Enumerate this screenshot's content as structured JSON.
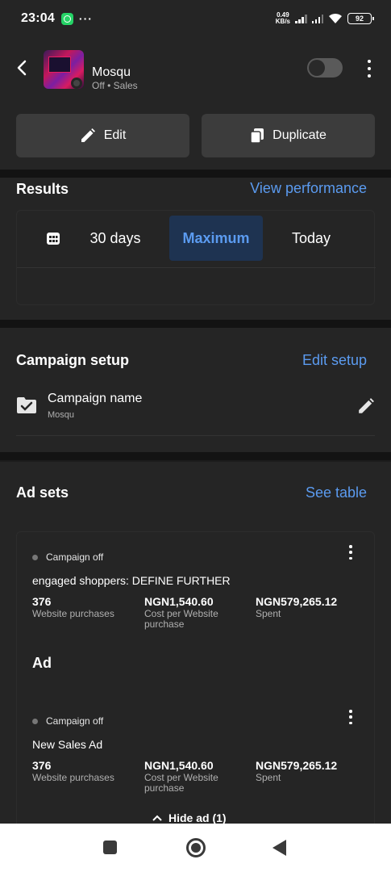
{
  "status_bar": {
    "time": "23:04",
    "more": "···",
    "speed_value": "0.49",
    "speed_unit": "KB/s",
    "battery": "92"
  },
  "header": {
    "campaign_title": "Mosqu",
    "campaign_subtitle": "Off • Sales"
  },
  "actions": {
    "edit_label": "Edit",
    "duplicate_label": "Duplicate"
  },
  "results": {
    "title": "Results",
    "link": "View performance",
    "tabs": [
      "30 days",
      "Maximum",
      "Today"
    ],
    "selected_tab": "Maximum"
  },
  "setup": {
    "title": "Campaign setup",
    "link": "Edit setup",
    "name_label": "Campaign name",
    "name_value": "Mosqu"
  },
  "ad_sets": {
    "title": "Ad sets",
    "link": "See table",
    "items": [
      {
        "status": "Campaign off",
        "name": "engaged shoppers: DEFINE FURTHER",
        "metrics": [
          {
            "value": "376",
            "label": "Website purchases"
          },
          {
            "value": "NGN1,540.60",
            "label": "Cost per Website purchase"
          },
          {
            "value": "NGN579,265.12",
            "label": "Spent"
          }
        ]
      }
    ],
    "ad_heading": "Ad",
    "ads": [
      {
        "status": "Campaign off",
        "name": "New Sales Ad",
        "metrics": [
          {
            "value": "376",
            "label": "Website purchases"
          },
          {
            "value": "NGN1,540.60",
            "label": "Cost per Website purchase"
          },
          {
            "value": "NGN579,265.12",
            "label": "Spent"
          }
        ]
      }
    ],
    "hide_label": "Hide ad (1)"
  },
  "colors": {
    "accent": "#5b9bf0",
    "selected_tab_bg": "#1e3351",
    "surface": "#252525",
    "background": "#1c1c1c"
  },
  "icons": [
    "back-arrow-icon",
    "edit-pencil-icon",
    "duplicate-icon",
    "calendar-icon",
    "folder-check-icon",
    "pencil-icon",
    "more-vertical-icon",
    "chevron-up-icon"
  ]
}
